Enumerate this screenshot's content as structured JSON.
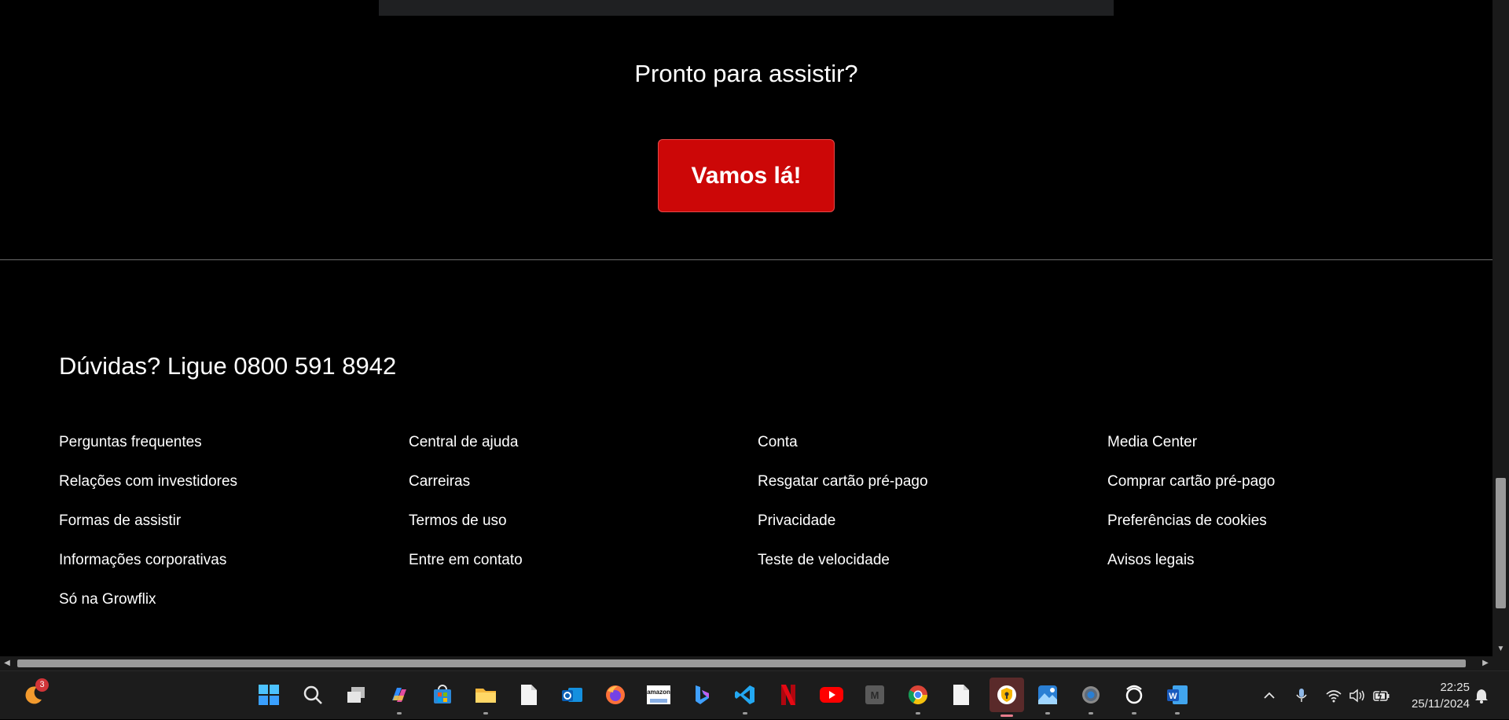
{
  "cta": {
    "title": "Pronto para assistir?",
    "button_label": "Vamos lá!"
  },
  "footer": {
    "phone_text": "Dúvidas? Ligue 0800 591 8942",
    "columns": [
      [
        "Perguntas frequentes",
        "Relações com investidores",
        "Formas de assistir",
        "Informações corporativas",
        "Só na Growflix"
      ],
      [
        "Central de ajuda",
        "Carreiras",
        "Termos de uso",
        "Entre em contato"
      ],
      [
        "Conta",
        "Resgatar cartão pré-pago",
        "Privacidade",
        "Teste de velocidade"
      ],
      [
        "Media Center",
        "Comprar cartão pré-pago",
        "Preferências de cookies",
        "Avisos legais"
      ]
    ]
  },
  "taskbar": {
    "weather_badge": "3",
    "apps": [
      "windows-start",
      "search",
      "task-view",
      "copilot",
      "microsoft-store",
      "file-explorer",
      "notepad-file",
      "outlook",
      "firefox",
      "amazon",
      "bing",
      "vscode",
      "netflix",
      "youtube",
      "m-app",
      "chrome",
      "file",
      "vpn-shield",
      "photos",
      "settings",
      "threads",
      "word"
    ],
    "clock": {
      "time": "22:25",
      "date": "25/11/2024"
    }
  },
  "colors": {
    "cta_button": "#cc0707",
    "background": "#000000",
    "taskbar": "#1c1c1c"
  }
}
